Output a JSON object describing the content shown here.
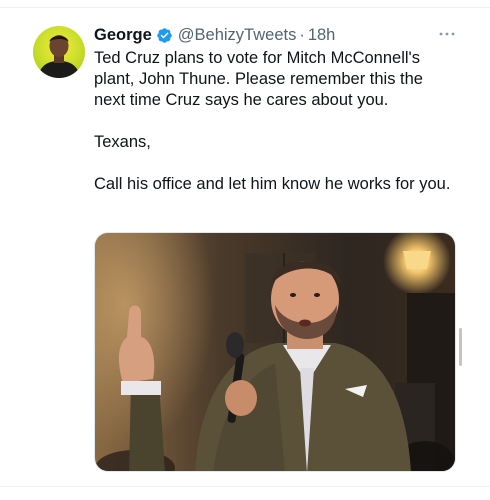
{
  "tweet": {
    "author": {
      "display_name": "George",
      "handle": "@BehizyTweets",
      "verified": true,
      "avatar_icon": "person-avatar"
    },
    "separator": "·",
    "timestamp": "18h",
    "more_icon": "more-horizontal-icon",
    "paragraphs": [
      "Ted Cruz plans to vote for Mitch McConnell's plant, John Thune. Please remember this the next time Cruz says he cares about you.",
      "Texans,",
      "Call his office and let him know he works for you."
    ],
    "media": {
      "type": "photo"
    }
  },
  "colors": {
    "text_primary": "#0f1419",
    "text_secondary": "#536471",
    "verified_blue": "#1d9bf0",
    "divider": "#eff3f4"
  }
}
